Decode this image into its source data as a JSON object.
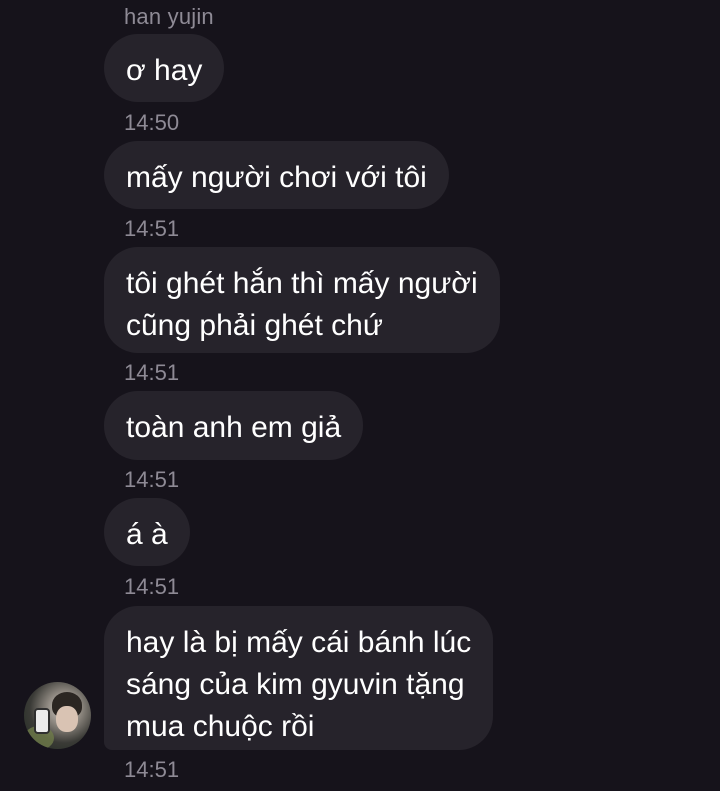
{
  "chat": {
    "sender_name": "han yujin",
    "messages": [
      {
        "text": "ơ hay",
        "time": "14:50"
      },
      {
        "text": "mấy người chơi với tôi",
        "time": "14:51"
      },
      {
        "lines": [
          "tôi ghét hắn thì mấy người",
          "cũng phải ghét chứ"
        ],
        "time": "14:51"
      },
      {
        "text": "toàn anh em giả",
        "time": "14:51"
      },
      {
        "text": "á à",
        "time": "14:51"
      },
      {
        "lines": [
          "hay là bị mấy cái bánh lúc",
          "sáng của kim gyuvin tặng",
          "mua chuộc rồi"
        ],
        "time": "14:51"
      }
    ]
  },
  "colors": {
    "background": "#16131b",
    "bubble": "#26232b",
    "meta_text": "#8e8a95"
  }
}
